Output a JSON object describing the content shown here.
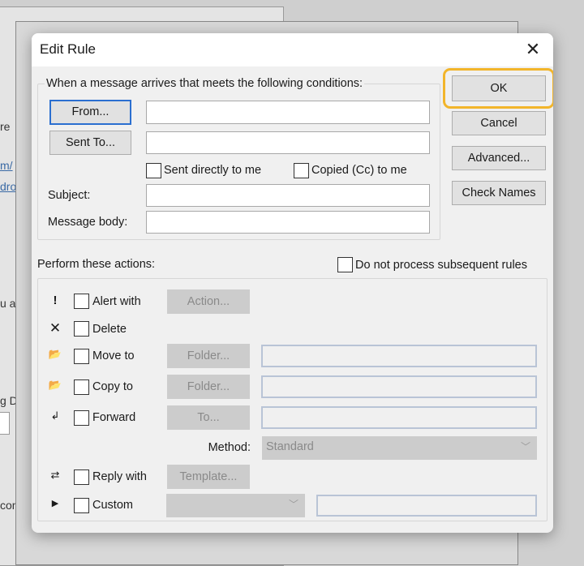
{
  "background": {
    "fragments": [
      "re",
      "m/",
      "dro",
      "u a",
      "g D",
      "con"
    ]
  },
  "dialog": {
    "title": "Edit Rule",
    "close_label": "✕",
    "conditions": {
      "group_label": "When a message arrives that meets the following conditions:",
      "from_button": "From...",
      "from_value": "",
      "sent_to_button": "Sent To...",
      "sent_to_value": "",
      "sent_directly_label": "Sent directly to me",
      "sent_directly_checked": false,
      "copied_label": "Copied (Cc) to me",
      "copied_checked": false,
      "subject_label": "Subject:",
      "subject_value": "",
      "body_label": "Message body:",
      "body_value": ""
    },
    "buttons": {
      "ok": "OK",
      "cancel": "Cancel",
      "advanced": "Advanced...",
      "check_names": "Check Names"
    },
    "highlight_color": "#f2b52b",
    "actions": {
      "label": "Perform these actions:",
      "do_not_process_label": "Do not process subsequent rules",
      "do_not_process_checked": false,
      "rows": [
        {
          "icon": "exclamation-icon",
          "label": "Alert with",
          "button": "Action...",
          "checked": false
        },
        {
          "icon": "delete-x-icon",
          "label": "Delete",
          "checked": false
        },
        {
          "icon": "move-folder-icon",
          "label": "Move to",
          "button": "Folder...",
          "value": "",
          "checked": false
        },
        {
          "icon": "copy-folder-icon",
          "label": "Copy to",
          "button": "Folder...",
          "value": "",
          "checked": false
        },
        {
          "icon": "forward-icon",
          "label": "Forward",
          "button": "To...",
          "value": "",
          "checked": false
        },
        {
          "icon": "reply-icon",
          "label": "Reply with",
          "button": "Template...",
          "checked": false
        },
        {
          "icon": "play-arrow-icon",
          "label": "Custom",
          "checked": false
        }
      ],
      "method_label": "Method:",
      "method_value": "Standard"
    }
  }
}
